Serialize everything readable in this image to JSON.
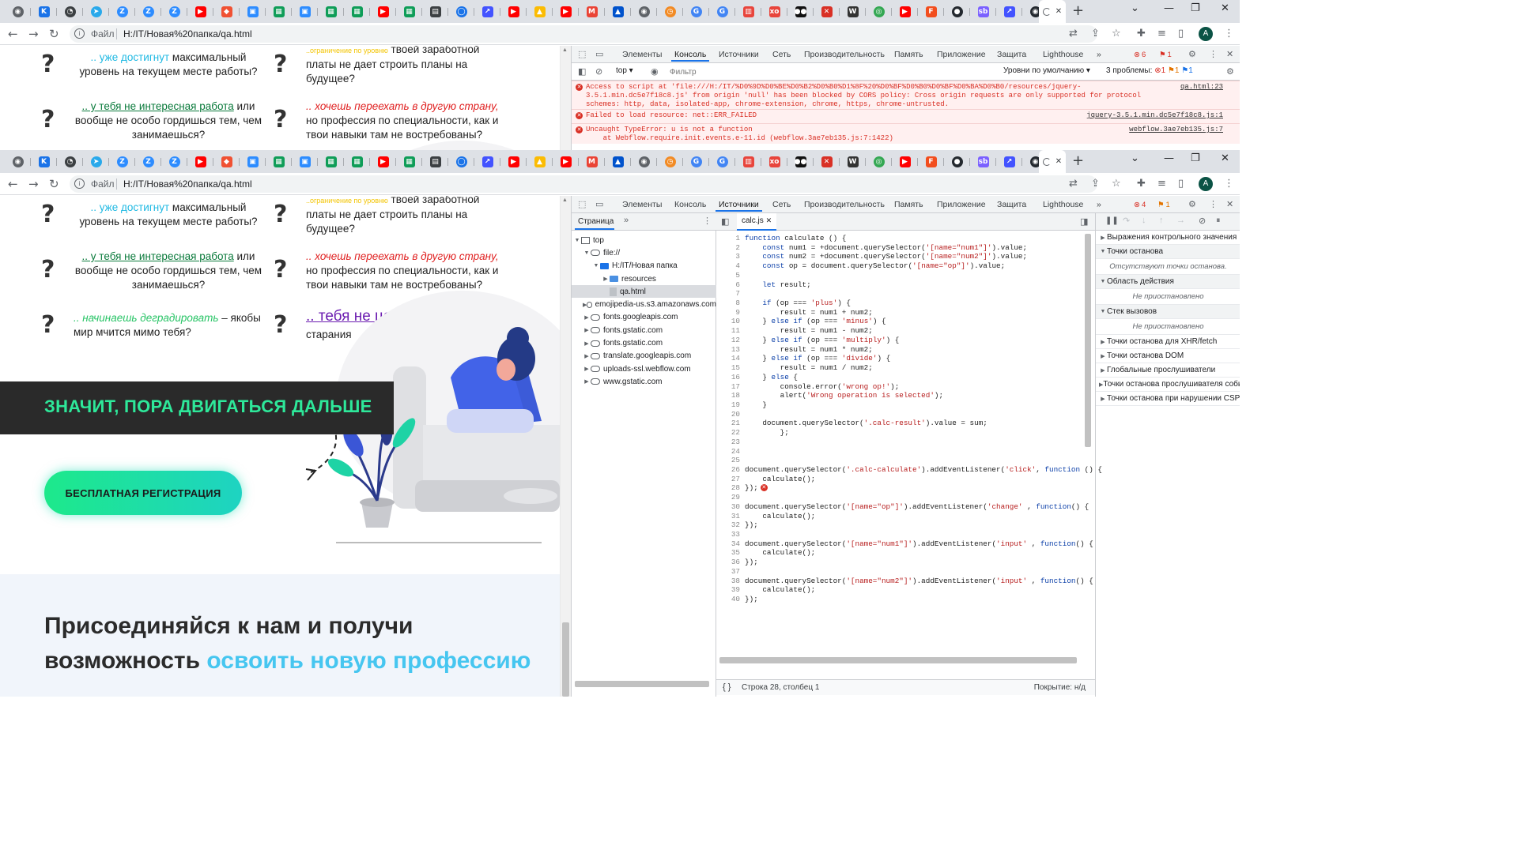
{
  "tabs": [
    {
      "icon": "chrome-icon",
      "color": "#5f6368",
      "glyph": "◉",
      "round": true
    },
    {
      "icon": "k-icon",
      "color": "#1a73e8",
      "glyph": "K",
      "round": false
    },
    {
      "icon": "github-like-icon",
      "color": "#3c4043",
      "glyph": "◔",
      "round": true
    },
    {
      "icon": "telegram-icon",
      "color": "#29a9eb",
      "glyph": "➤",
      "round": true
    },
    {
      "icon": "zoom-z-icon",
      "color": "#2d8cff",
      "glyph": "Z",
      "round": true
    },
    {
      "icon": "zoom-z-icon",
      "color": "#2d8cff",
      "glyph": "Z",
      "round": true
    },
    {
      "icon": "zoom-z-icon",
      "color": "#2d8cff",
      "glyph": "Z",
      "round": true
    },
    {
      "icon": "youtube-icon",
      "color": "#ff0000",
      "glyph": "▶",
      "round": false
    },
    {
      "icon": "git-icon",
      "color": "#f05133",
      "glyph": "◆",
      "round": false
    },
    {
      "icon": "zoom-video-icon",
      "color": "#2d8cff",
      "glyph": "▣",
      "round": false
    },
    {
      "icon": "sheets-icon",
      "color": "#0f9d58",
      "glyph": "▦",
      "round": false
    },
    {
      "icon": "zoom-video-icon",
      "color": "#2d8cff",
      "glyph": "▣",
      "round": false
    },
    {
      "icon": "sheets-icon",
      "color": "#0f9d58",
      "glyph": "▦",
      "round": false
    },
    {
      "icon": "sheets-icon",
      "color": "#0f9d58",
      "glyph": "▦",
      "round": false
    },
    {
      "icon": "youtube-icon",
      "color": "#ff0000",
      "glyph": "▶",
      "round": false
    },
    {
      "icon": "sheets-icon",
      "color": "#0f9d58",
      "glyph": "▦",
      "round": false
    },
    {
      "icon": "calc-icon",
      "color": "#3c4043",
      "glyph": "▤",
      "round": false
    },
    {
      "icon": "pin-icon",
      "color": "#1a73e8",
      "glyph": "◯",
      "round": true
    },
    {
      "icon": "webflow-icon",
      "color": "#4353ff",
      "glyph": "↗",
      "round": false
    },
    {
      "icon": "youtube-icon",
      "color": "#ff0000",
      "glyph": "▶",
      "round": false
    },
    {
      "icon": "drive-icon",
      "color": "#fbbc04",
      "glyph": "▲",
      "round": false
    },
    {
      "icon": "youtube-icon",
      "color": "#ff0000",
      "glyph": "▶",
      "round": false
    },
    {
      "icon": "gmail-icon",
      "color": "#ea4335",
      "glyph": "M",
      "round": false
    },
    {
      "icon": "atlassian-icon",
      "color": "#0052cc",
      "glyph": "▲",
      "round": false
    },
    {
      "icon": "chrome-icon",
      "color": "#5f6368",
      "glyph": "◉",
      "round": true
    },
    {
      "icon": "history-icon",
      "color": "#f28b25",
      "glyph": "◷",
      "round": true
    },
    {
      "icon": "google-icon",
      "color": "#4285f4",
      "glyph": "G",
      "round": true
    },
    {
      "icon": "google-icon",
      "color": "#4285f4",
      "glyph": "G",
      "round": true
    },
    {
      "icon": "basket-icon",
      "color": "#e8453c",
      "glyph": "▥",
      "round": false
    },
    {
      "icon": "xo-icon",
      "color": "#e8453c",
      "glyph": "xo",
      "round": false
    },
    {
      "icon": "medium-icon",
      "color": "#111111",
      "glyph": "●●",
      "round": false
    },
    {
      "icon": "x-red-icon",
      "color": "#d93025",
      "glyph": "✕",
      "round": false
    },
    {
      "icon": "wikipedia-icon",
      "color": "#333333",
      "glyph": "W",
      "round": false
    },
    {
      "icon": "green-circle-icon",
      "color": "#34a853",
      "glyph": "◎",
      "round": true
    },
    {
      "icon": "youtube-icon",
      "color": "#ff0000",
      "glyph": "▶",
      "round": false
    },
    {
      "icon": "figma-f-icon",
      "color": "#f24e1e",
      "glyph": "F",
      "round": false
    },
    {
      "icon": "github-icon",
      "color": "#24292f",
      "glyph": "●",
      "round": true
    },
    {
      "icon": "sb-icon",
      "color": "#7b61ff",
      "glyph": "sb",
      "round": false
    },
    {
      "icon": "webflow-icon",
      "color": "#4353ff",
      "glyph": "↗",
      "round": false
    },
    {
      "icon": "circle-icon",
      "color": "#24292f",
      "glyph": "◉",
      "round": true
    }
  ],
  "browser": {
    "file_label": "Файл",
    "url": "H:/IT/Новая%20папка/qa.html",
    "new_tab": "+",
    "tab_close": "✕",
    "profile_initial": "A"
  },
  "page": {
    "q1": {
      "green": ".. уже достигнут",
      "rest": " максимальный уровень на текущем месте работы?"
    },
    "q2": {
      "yellow": "..ограничение по уровню",
      "rest": " твоей заработной платы не дает строить планы на будущее?"
    },
    "q3": {
      "green": ".. у тебя не интересная работа",
      "rest": " или вообще не особо гордишься тем, чем занимаешься?"
    },
    "q4": {
      "red": ".. хочешь переехать в другую страну,",
      "rest": " но профессия по специальности, как и твои навыки там не востребованы?"
    },
    "q5": {
      "green": ".. начинаешь деградировать",
      "rest": " – якобы мир мчится мимо тебя?"
    },
    "q6": {
      "purple": ".. тебя не ценят",
      "rest": " за твои знания и старания"
    },
    "question_mark": "?",
    "banner": "ЗНАЧИТ, ПОРА ДВИГАТЬСЯ ДАЛЬШЕ",
    "register_button": "БЕСПЛАТНАЯ РЕГИСТРАЦИЯ",
    "join_heading": "Присоединяйся к нам и получи возможность ",
    "join_heading_accent": "освоить новую профессию"
  },
  "devtools_tabs": {
    "elements": "Элементы",
    "console": "Консоль",
    "sources": "Источники",
    "network": "Сеть",
    "performance": "Производительность",
    "memory": "Память",
    "application": "Приложение",
    "security": "Защита",
    "lighthouse": "Lighthouse",
    "more": "»"
  },
  "devtools_top": {
    "errors": "6",
    "warnings": "1"
  },
  "devtools_bottom": {
    "errors": "4",
    "warnings": "1"
  },
  "console": {
    "context": "top",
    "filter_placeholder": "Фильтр",
    "levels": "Уровни по умолчанию",
    "issues_label": "3 проблемы:",
    "issues_err": "1",
    "issues_warn": "1",
    "issues_info": "1",
    "messages": [
      {
        "text": "Access to script at 'file:///H:/IT/%D0%9D%D0%BE%D0%B2%D0%B0%D1%8F%20%D0%BF%D0%B0%D0%BF%D0%BA%D0%B0/resources/jquery-3.5.1.min.dc5e7f18c8.js' from origin 'null' has been blocked by CORS policy: Cross origin requests are only supported for protocol schemes: http, data, isolated-app, chrome-extension, chrome, https, chrome-untrusted.",
        "source": "qa.html:23"
      },
      {
        "text": "Failed to load resource: net::ERR_FAILED",
        "source": "jquery-3.5.1.min.dc5e7f18c8.js:1"
      },
      {
        "text": "Uncaught TypeError: u is not a function\n    at Webflow.require.init.events.e-11.id (webflow.3ae7eb135.js:7:1422)",
        "source": "webflow.3ae7eb135.js:7"
      }
    ]
  },
  "sources": {
    "page_tab": "Страница",
    "file_tab": "calc.js",
    "tree": [
      {
        "label": "top",
        "depth": 0,
        "kind": "frame",
        "open": true
      },
      {
        "label": "file://",
        "depth": 1,
        "kind": "cloud",
        "open": true
      },
      {
        "label": "H:/IT/Новая папка",
        "depth": 2,
        "kind": "folder",
        "open": true
      },
      {
        "label": "resources",
        "depth": 3,
        "kind": "folder-closed",
        "open": false
      },
      {
        "label": "qa.html",
        "depth": 3,
        "kind": "file",
        "open": false,
        "selected": true
      },
      {
        "label": "emojipedia-us.s3.amazonaws.com",
        "depth": 1,
        "kind": "cloud",
        "open": false
      },
      {
        "label": "fonts.googleapis.com",
        "depth": 1,
        "kind": "cloud",
        "open": false
      },
      {
        "label": "fonts.gstatic.com",
        "depth": 1,
        "kind": "cloud",
        "open": false
      },
      {
        "label": "fonts.gstatic.com",
        "depth": 1,
        "kind": "cloud",
        "open": false
      },
      {
        "label": "translate.googleapis.com",
        "depth": 1,
        "kind": "cloud",
        "open": false
      },
      {
        "label": "uploads-ssl.webflow.com",
        "depth": 1,
        "kind": "cloud",
        "open": false
      },
      {
        "label": "www.gstatic.com",
        "depth": 1,
        "kind": "cloud",
        "open": false
      }
    ],
    "code": [
      "function calculate () {",
      "    const num1 = +document.querySelector('[name=\"num1\"]').value;",
      "    const num2 = +document.querySelector('[name=\"num2\"]').value;",
      "    const op = document.querySelector('[name=\"op\"]').value;",
      "",
      "    let result;",
      "",
      "    if (op === 'plus') {",
      "        result = num1 + num2;",
      "    } else if (op === 'minus') {",
      "        result = num1 - num2;",
      "    } else if (op === 'multiply') {",
      "        result = num1 * num2;",
      "    } else if (op === 'divide') {",
      "        result = num1 / num2;",
      "    } else {",
      "        console.error('wrong op!');",
      "        alert('Wrong operation is selected');",
      "    }",
      "",
      "    document.querySelector('.calc-result').value = sum;",
      "        };",
      "",
      "",
      "",
      "document.querySelector('.calc-calculate').addEventListener('click', function () {",
      "    calculate();",
      "});",
      "",
      "document.querySelector('[name=\"op\"]').addEventListener('change' , function() {",
      "    calculate();",
      "});",
      "",
      "document.querySelector('[name=\"num1\"]').addEventListener('input' , function() {",
      "    calculate();",
      "});",
      "",
      "document.querySelector('[name=\"num2\"]').addEventListener('input' , function() {",
      "    calculate();",
      "});"
    ],
    "error_line": 28,
    "status_position": "Строка 28, столбец 1",
    "status_coverage": "Покрытие: н/д",
    "debugger_sections": [
      {
        "label": "Выражения контрольного значения",
        "open": false
      },
      {
        "label": "Точки останова",
        "open": true,
        "sub": "Отсутствуют точки останова."
      },
      {
        "label": "Область действия",
        "open": true,
        "sub": "Не приостановлено"
      },
      {
        "label": "Стек вызовов",
        "open": true,
        "sub": "Не приостановлено"
      },
      {
        "label": "Точки останова для XHR/fetch",
        "open": false
      },
      {
        "label": "Точки останова DOM",
        "open": false
      },
      {
        "label": "Глобальные прослушиватели",
        "open": false
      },
      {
        "label": "Точки останова прослушивателя событий",
        "open": false
      },
      {
        "label": "Точки останова при нарушении CSP",
        "open": false
      }
    ]
  }
}
